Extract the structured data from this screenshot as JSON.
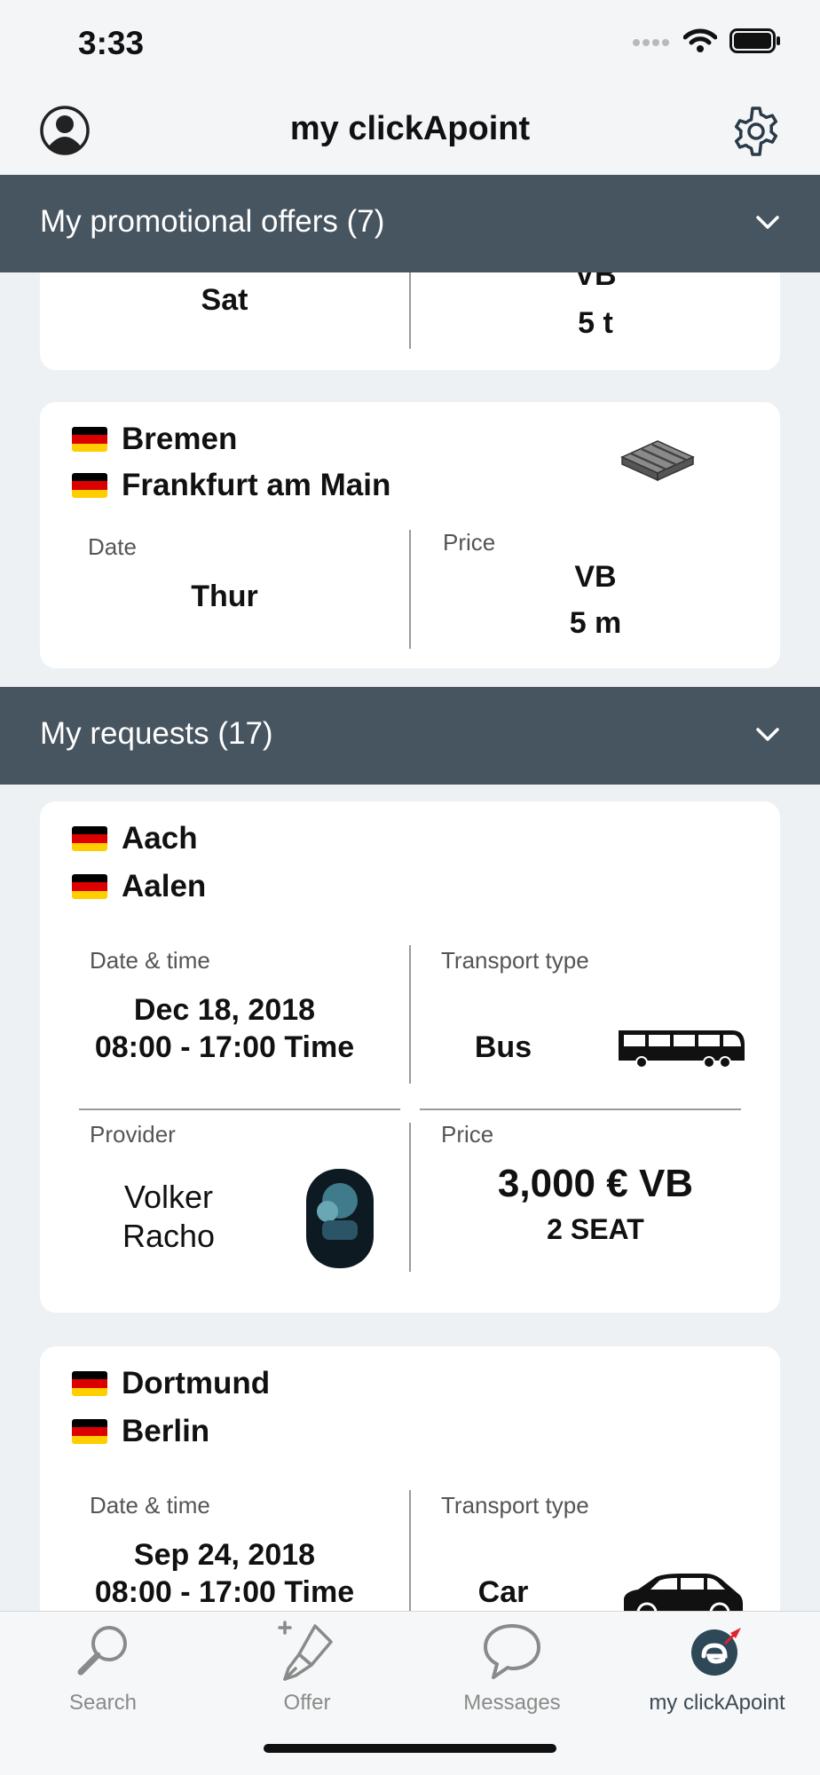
{
  "status": {
    "time": "3:33"
  },
  "nav": {
    "title": "my clickApoint"
  },
  "sections": {
    "promotional": "My promotional offers (7)",
    "requests": "My requests (17)"
  },
  "promo_cards": [
    {
      "day": "Sat",
      "price_top": "VB",
      "amount": "5 t"
    },
    {
      "from": "Bremen",
      "to": "Frankfurt am Main",
      "date_label": "Date",
      "date": "Thur",
      "price_label": "Price",
      "price": "VB",
      "amount": "5 m"
    }
  ],
  "request_cards": [
    {
      "from": "Aach",
      "to": "Aalen",
      "datetime_label": "Date & time",
      "date": "Dec 18, 2018",
      "time": "08:00 - 17:00 Time",
      "transport_label": "Transport type",
      "transport": "Bus",
      "provider_label": "Provider",
      "provider": "Volker Racho",
      "price_label": "Price",
      "price": "3,000 € VB",
      "seats": "2 SEAT"
    },
    {
      "from": "Dortmund",
      "to": "Berlin",
      "datetime_label": "Date & time",
      "date": "Sep 24, 2018",
      "time": "08:00 - 17:00 Time",
      "transport_label": "Transport type",
      "transport": "Car"
    }
  ],
  "tabs": [
    {
      "label": "Search",
      "icon": "search-icon"
    },
    {
      "label": "Offer",
      "icon": "pen-icon"
    },
    {
      "label": "Messages",
      "icon": "chat-icon"
    },
    {
      "label": "my clickApoint",
      "icon": "clickapoint-logo-icon",
      "active": true
    }
  ],
  "colors": {
    "header": "#475560",
    "background": "#eef1f4",
    "active_tab": "#3d4a54"
  }
}
